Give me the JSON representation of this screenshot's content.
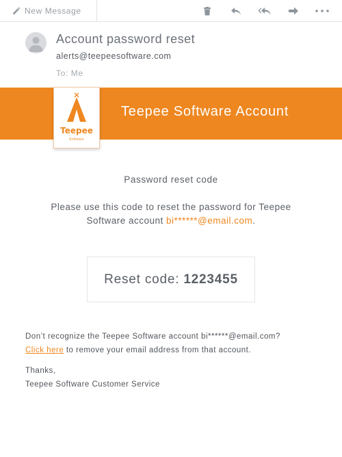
{
  "toolbar": {
    "new_message_label": "New Message",
    "icons": [
      "trash-icon",
      "reply-icon",
      "reply-all-icon",
      "forward-icon",
      "more-icon"
    ]
  },
  "email": {
    "subject": "Account password reset",
    "sender": "alerts@teepeesoftware.com",
    "to": "To: Me"
  },
  "banner": {
    "logo_name": "Teepee",
    "logo_sub": "Software",
    "title": "Teepee Software Account",
    "color": "#ee8720"
  },
  "body": {
    "heading": "Password reset code",
    "instructions_prefix": "Please use this code to reset the password for Teepee Software account ",
    "masked_email": "bi******@email.com",
    "instructions_suffix": ".",
    "code_label": "Reset code:",
    "code_value": "1223455",
    "unrecognized_text": "Don’t recognize the Teepee Software account bi******@email.com?",
    "link_text": "Click here",
    "link_suffix": " to remove your email address from that account.",
    "thanks": "Thanks,",
    "signature": "Teepee Software Customer Service"
  }
}
